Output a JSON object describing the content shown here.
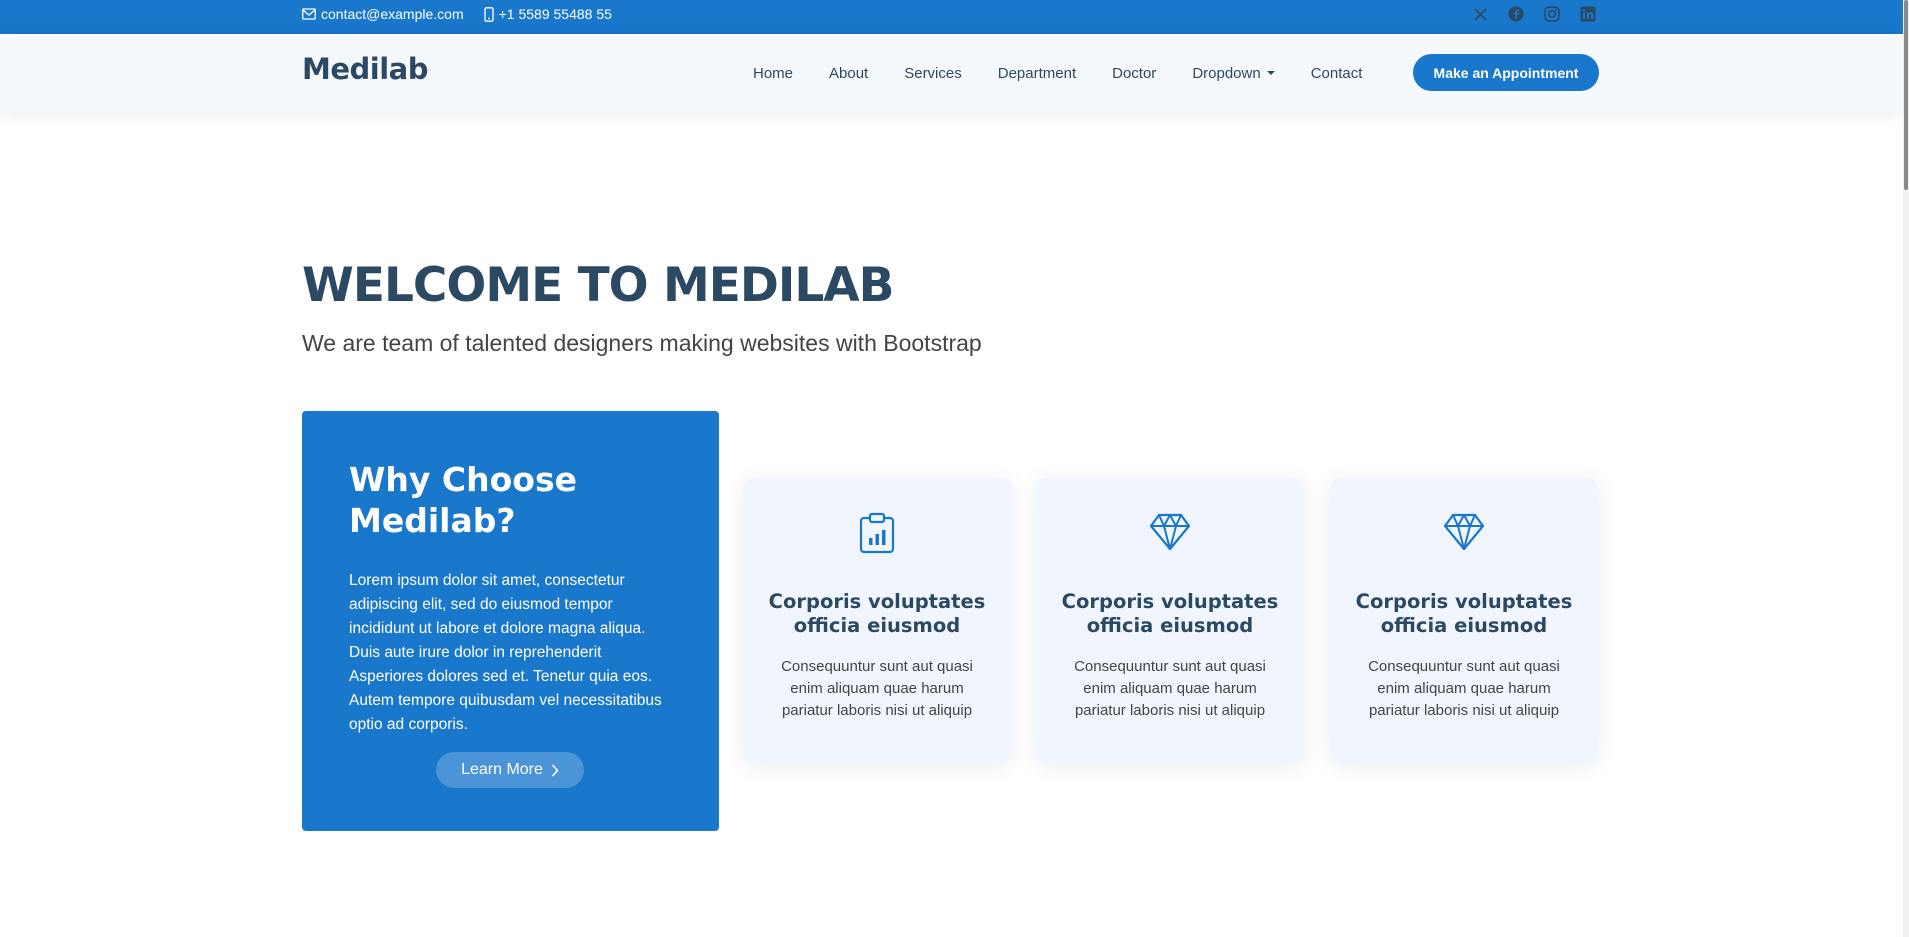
{
  "topbar": {
    "email": "contact@example.com",
    "phone": "+1 5589 55488 55",
    "social": [
      "x-icon",
      "facebook-icon",
      "instagram-icon",
      "linkedin-icon"
    ]
  },
  "header": {
    "logo": "Medilab",
    "nav": [
      "Home",
      "About",
      "Services",
      "Department",
      "Doctor",
      "Dropdown",
      "Contact"
    ],
    "cta": "Make an Appointment"
  },
  "hero": {
    "title": "WELCOME TO MEDILAB",
    "subtitle": "We are team of talented designers making websites with Bootstrap"
  },
  "why": {
    "title_line1": "Why Choose",
    "title_line2": "Medilab?",
    "text": "Lorem ipsum dolor sit amet, consectetur adipiscing elit, sed do eiusmod tempor incididunt ut labore et dolore magna aliqua. Duis aute irure dolor in reprehenderit Asperiores dolores sed et. Tenetur quia eos. Autem tempore quibusdam vel necessitatibus optio ad corporis.",
    "button": "Learn More"
  },
  "cards": [
    {
      "icon": "clipboard-data-icon",
      "title": "Corporis voluptates officia eiusmod",
      "text": "Consequuntur sunt aut quasi enim aliquam quae harum pariatur laboris nisi ut aliquip"
    },
    {
      "icon": "gem-icon",
      "title": "Corporis voluptates officia eiusmod",
      "text": "Consequuntur sunt aut quasi enim aliquam quae harum pariatur laboris nisi ut aliquip"
    },
    {
      "icon": "gem-icon",
      "title": "Corporis voluptates officia eiusmod",
      "text": "Consequuntur sunt aut quasi enim aliquam quae harum pariatur laboris nisi ut aliquip"
    }
  ],
  "colors": {
    "accent": "#1977cc",
    "heading": "#2c4964",
    "card_bg": "#f1f6fe",
    "header_bg": "#f6f9fc"
  }
}
